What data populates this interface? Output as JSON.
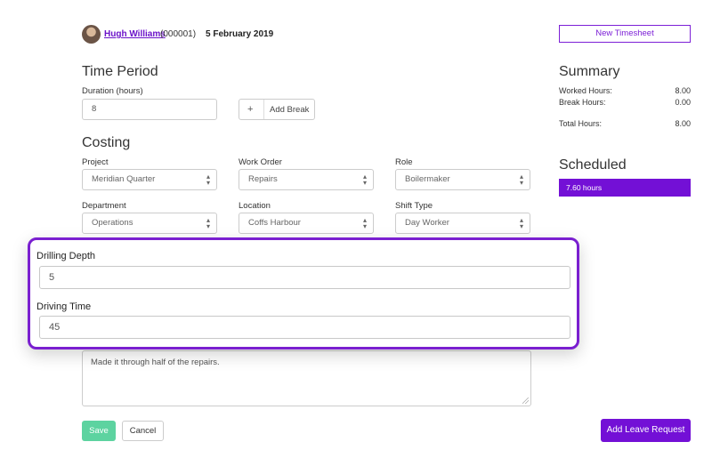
{
  "header": {
    "user_name": "Hugh Williams",
    "user_id": "(000001)",
    "date": "5 February 2019",
    "new_timesheet_label": "New Timesheet"
  },
  "time_period": {
    "heading": "Time Period",
    "duration_label": "Duration (hours)",
    "duration_value": "8",
    "add_break_icon": "+",
    "add_break_label": "Add Break"
  },
  "costing": {
    "heading": "Costing",
    "project_label": "Project",
    "project_value": "Meridian Quarter",
    "work_order_label": "Work Order",
    "work_order_value": "Repairs",
    "role_label": "Role",
    "role_value": "Boilermaker",
    "department_label": "Department",
    "department_value": "Operations",
    "location_label": "Location",
    "location_value": "Coffs Harbour",
    "shift_type_label": "Shift Type",
    "shift_type_value": "Day Worker"
  },
  "summary": {
    "heading": "Summary",
    "worked_label": "Worked Hours:",
    "worked_value": "8.00",
    "break_label": "Break Hours:",
    "break_value": "0.00",
    "total_label": "Total Hours:",
    "total_value": "8.00"
  },
  "scheduled": {
    "heading": "Scheduled",
    "value": "7.60 hours"
  },
  "custom_fields": {
    "drilling_depth_label": "Drilling Depth",
    "drilling_depth_value": "5",
    "driving_time_label": "Driving Time",
    "driving_time_value": "45"
  },
  "notes": {
    "value": "Made it through half of the repairs."
  },
  "actions": {
    "save_label": "Save",
    "cancel_label": "Cancel",
    "leave_request_label": "Add Leave Request"
  },
  "colors": {
    "accent": "#7310d6",
    "save": "#5dd3a0"
  }
}
